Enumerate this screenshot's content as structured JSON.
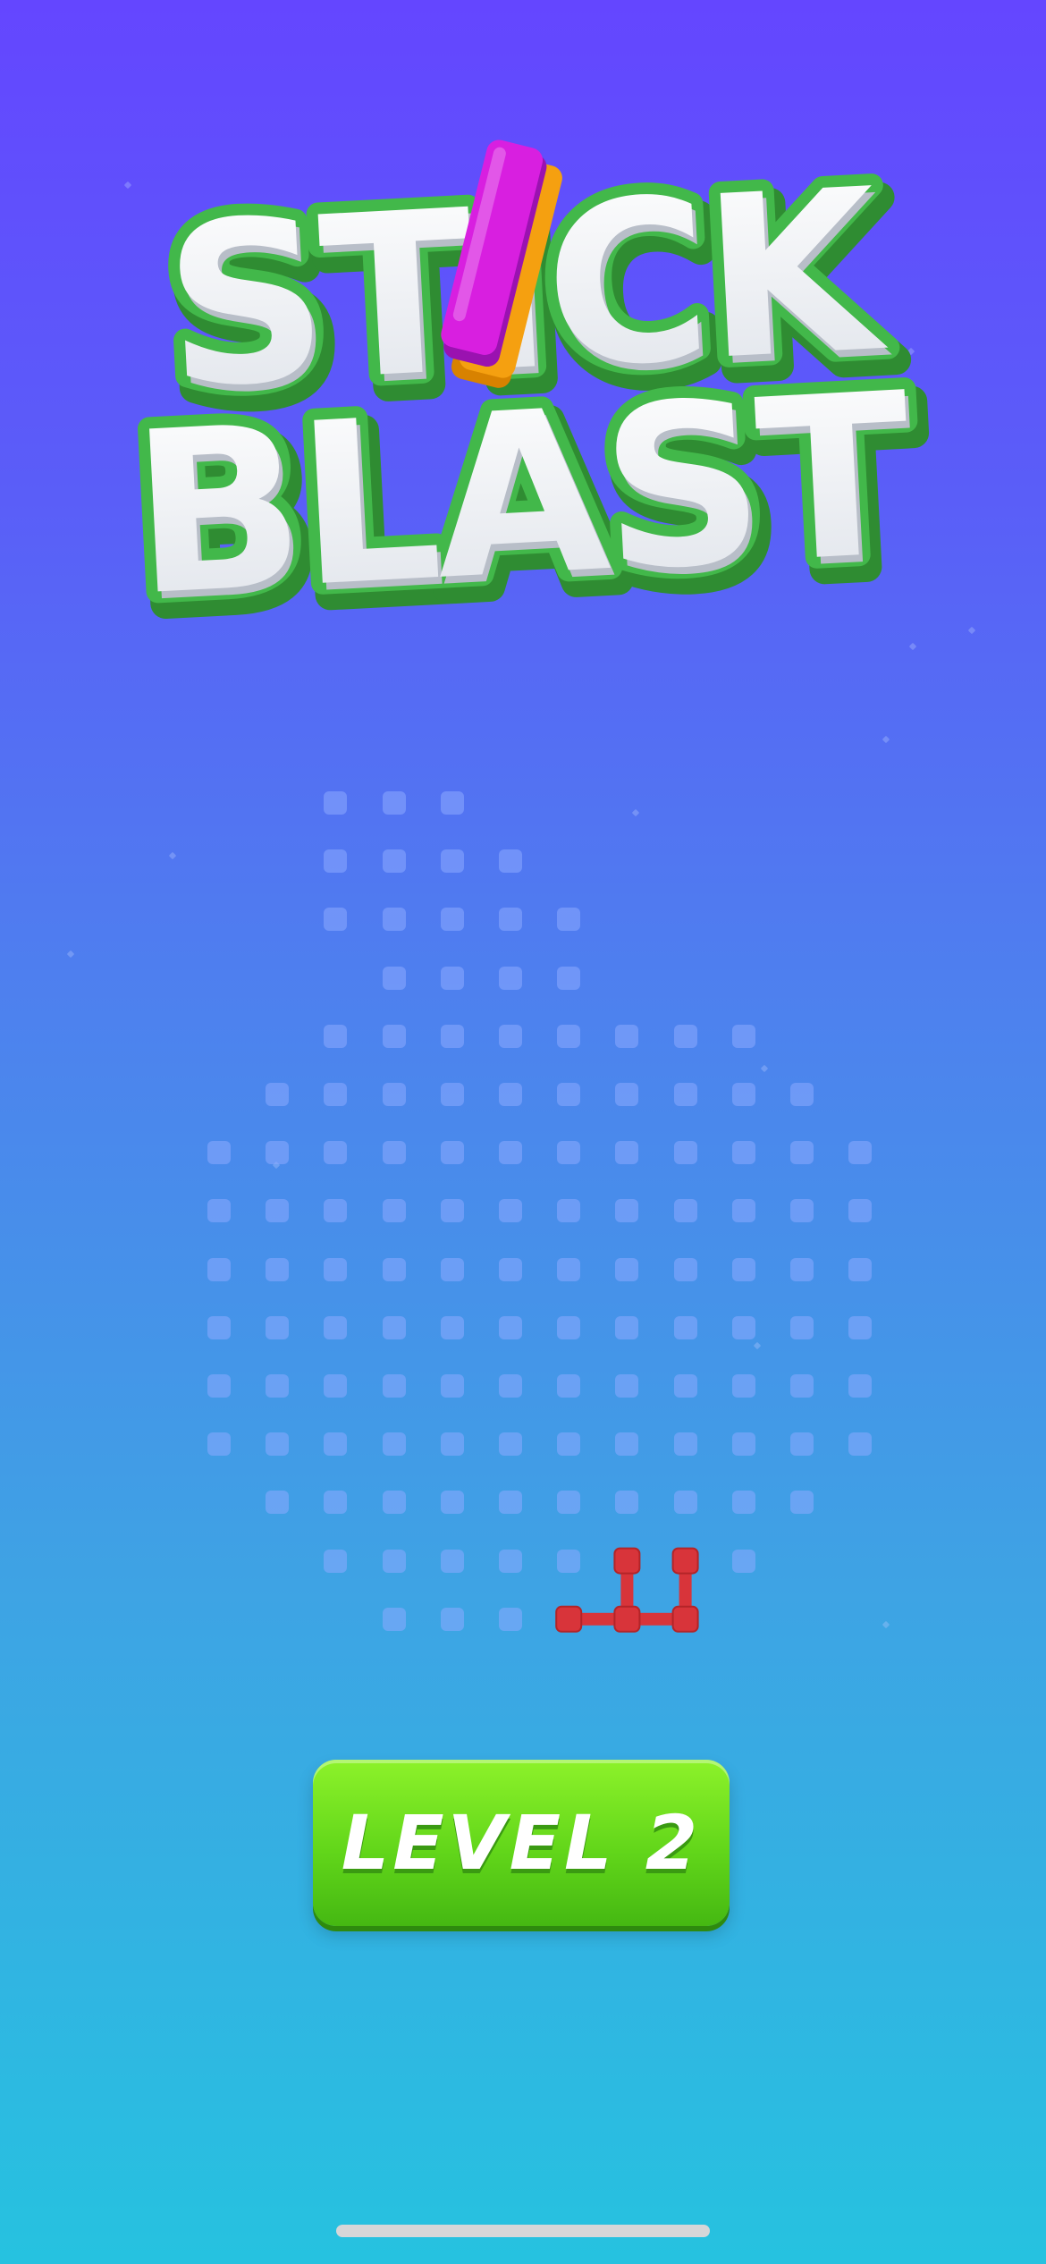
{
  "game": {
    "title_line1": "STICK",
    "title_line2": "BLAST"
  },
  "level_button": {
    "label": "LEVEL 2"
  },
  "board": {
    "rows": [
      {
        "cols": [
          2,
          3,
          4
        ]
      },
      {
        "cols": [
          2,
          3,
          4,
          5
        ]
      },
      {
        "cols": [
          2,
          3,
          4,
          5,
          6
        ]
      },
      {
        "cols": [
          3,
          4,
          5,
          6
        ]
      },
      {
        "cols": [
          2,
          3,
          4,
          5,
          6,
          7,
          8,
          9
        ]
      },
      {
        "cols": [
          1,
          2,
          3,
          4,
          5,
          6,
          7,
          8,
          9,
          10
        ]
      },
      {
        "cols": [
          0,
          1,
          2,
          3,
          4,
          5,
          6,
          7,
          8,
          9,
          10,
          11
        ]
      },
      {
        "cols": [
          0,
          1,
          2,
          3,
          4,
          5,
          6,
          7,
          8,
          9,
          10,
          11
        ]
      },
      {
        "cols": [
          0,
          1,
          2,
          3,
          4,
          5,
          6,
          7,
          8,
          9,
          10,
          11
        ]
      },
      {
        "cols": [
          0,
          1,
          2,
          3,
          4,
          5,
          6,
          7,
          8,
          9,
          10,
          11
        ]
      },
      {
        "cols": [
          0,
          1,
          2,
          3,
          4,
          5,
          6,
          7,
          8,
          9,
          10,
          11
        ]
      },
      {
        "cols": [
          0,
          1,
          2,
          3,
          4,
          5,
          6,
          7,
          8,
          9,
          10,
          11
        ]
      },
      {
        "cols": [
          1,
          2,
          3,
          4,
          5,
          6,
          7,
          8,
          9,
          10
        ]
      },
      {
        "cols": [
          2,
          3,
          4,
          5,
          6,
          7,
          8,
          9
        ]
      },
      {
        "cols": [
          3,
          4,
          5,
          6,
          7,
          8
        ]
      }
    ],
    "piece": {
      "color": "#d8343a",
      "nodes": [
        [
          7,
          13
        ],
        [
          8,
          13
        ],
        [
          6,
          14
        ],
        [
          7,
          14
        ],
        [
          8,
          14
        ]
      ],
      "sticks": [
        [
          [
            7,
            13
          ],
          [
            7,
            14
          ]
        ],
        [
          [
            8,
            13
          ],
          [
            8,
            14
          ]
        ],
        [
          [
            6,
            14
          ],
          [
            7,
            14
          ]
        ],
        [
          [
            7,
            14
          ],
          [
            8,
            14
          ]
        ]
      ]
    }
  },
  "colors": {
    "bg_top": "#6446ff",
    "bg_bottom": "#26c2e0",
    "button_green": "#62d61a",
    "logo_green": "#3aa83c",
    "stick_magenta": "#d81fe0",
    "stick_orange": "#f5a010"
  }
}
